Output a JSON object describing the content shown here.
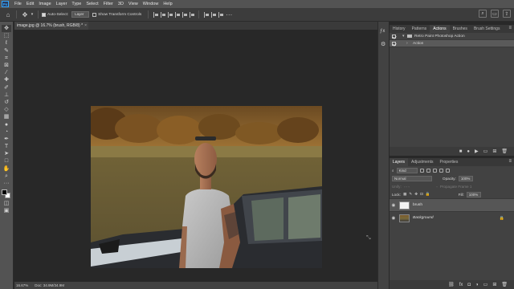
{
  "menubar": {
    "logo": "Ps",
    "items": [
      "File",
      "Edit",
      "Image",
      "Layer",
      "Type",
      "Select",
      "Filter",
      "3D",
      "View",
      "Window",
      "Help"
    ]
  },
  "options": {
    "auto_select_label": "Auto-Select:",
    "auto_select_value": "Layer",
    "transform_label": "Show Transform Controls"
  },
  "document": {
    "tab_title": "image.jpg @ 16.7% (brush, RGB/8) *",
    "close": "×"
  },
  "status": {
    "zoom": "16.67%",
    "doc_size": "Doc: 34.9M/34.9M"
  },
  "actions_panel": {
    "tabs": [
      "History",
      "Patterns",
      "Actions",
      "Brushes",
      "Brush Settings"
    ],
    "active_tab": "Actions",
    "rows": [
      {
        "label": "Retro Paint Photoshop Action",
        "type": "set"
      },
      {
        "label": "Action",
        "type": "action"
      }
    ]
  },
  "layers_panel": {
    "tabs": [
      "Layers",
      "Adjustments",
      "Properties"
    ],
    "active_tab": "Layers",
    "kind_label": "Kind",
    "blend_mode": "Normal",
    "opacity_label": "Opacity:",
    "opacity_value": "100%",
    "lock_label": "Lock:",
    "fill_label": "Fill:",
    "fill_value": "100%",
    "unify_label": "Unify:",
    "propagate_label": "Propagate Frame 1",
    "layers": [
      {
        "name": "brush",
        "selected": true
      },
      {
        "name": "Background",
        "selected": false,
        "locked": true
      }
    ]
  },
  "colors": {
    "accent": "#31a8ff",
    "foreground": "#000000",
    "background": "#ffffff"
  }
}
